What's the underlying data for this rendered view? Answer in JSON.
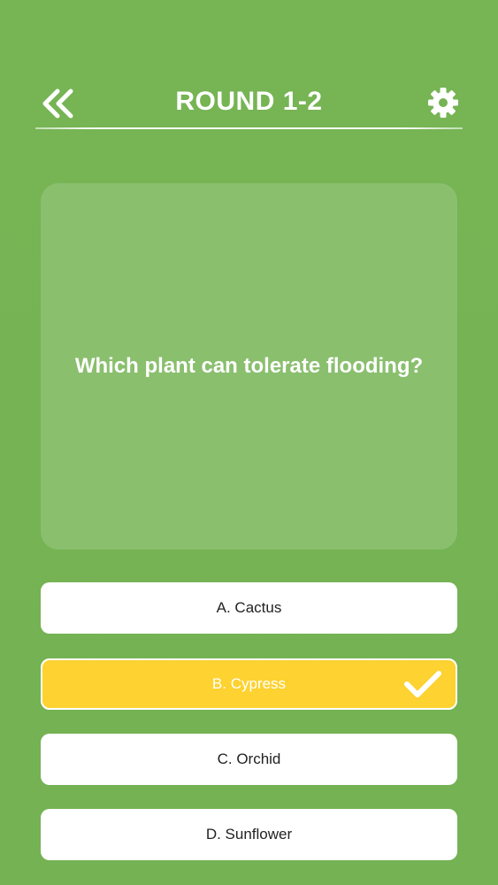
{
  "header": {
    "title": "ROUND 1-2",
    "back_icon": "double-chevron-left-icon",
    "settings_icon": "gear-icon"
  },
  "question": {
    "text": "Which plant can tolerate flooding?"
  },
  "options": [
    {
      "label": "A. Cactus",
      "selected": false
    },
    {
      "label": "B. Cypress",
      "selected": true
    },
    {
      "label": "C. Orchid",
      "selected": false
    },
    {
      "label": "D. Sunflower",
      "selected": false
    }
  ],
  "colors": {
    "background": "#75b354",
    "card": "#8abf6e",
    "option": "#ffffff",
    "selected_option": "#fdd231",
    "text_light": "#ffffff",
    "text_dark": "#222222"
  }
}
